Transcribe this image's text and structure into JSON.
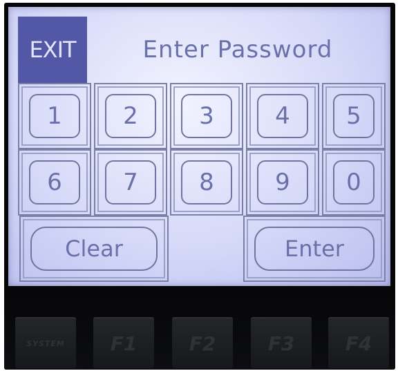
{
  "header": {
    "exit_label": "EXIT",
    "title": "Enter Password"
  },
  "keypad": {
    "row1": [
      "1",
      "2",
      "3",
      "4",
      "5"
    ],
    "row2": [
      "6",
      "7",
      "8",
      "9",
      "0"
    ],
    "clear_label": "Clear",
    "enter_label": "Enter"
  },
  "function_keys": [
    "SYSTEM",
    "F1",
    "F2",
    "F3",
    "F4"
  ],
  "colors": {
    "lcd_background": "#d6d9f8",
    "lcd_foreground": "#6a70a8",
    "exit_highlight": "#5358a6",
    "bezel": "#060608"
  }
}
